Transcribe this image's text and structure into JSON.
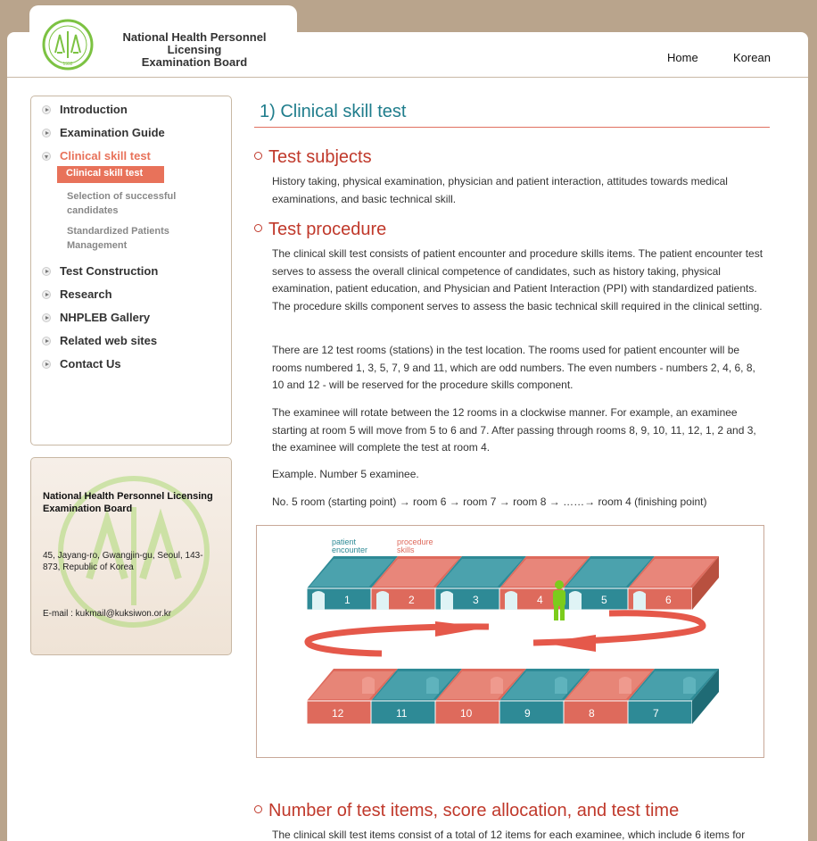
{
  "header": {
    "org_name_line1": "National Health Personnel Licensing",
    "org_name_line2": "Examination Board",
    "emblem_year": "1992",
    "nav": [
      {
        "label": "Home"
      },
      {
        "label": "Korean"
      }
    ]
  },
  "sidebar": {
    "items": [
      {
        "label": "Introduction"
      },
      {
        "label": "Examination Guide"
      },
      {
        "label": "Clinical skill test"
      },
      {
        "label": "Test Construction"
      },
      {
        "label": "Research"
      },
      {
        "label": "NHPLEB Gallery"
      },
      {
        "label": "Related web sites"
      },
      {
        "label": "Contact Us"
      }
    ],
    "subitems": [
      {
        "label": "Clinical skill test"
      },
      {
        "label": "Selection of successful candidates"
      },
      {
        "label": "Standardized Patients Management"
      }
    ]
  },
  "address": {
    "org": "National Health Personnel Licensing Examination Board",
    "street": "45, Jayang-ro, Gwangjin-gu, Seoul, 143-873, Republic of Korea",
    "email": "E-mail : kukmail@kuksiwon.or.kr"
  },
  "main": {
    "title": "1) Clinical skill test",
    "sections": [
      {
        "heading": "Test subjects"
      },
      {
        "heading": "Test procedure"
      },
      {
        "heading": "Number of test items, score allocation, and test time"
      }
    ],
    "paragraphs": [
      "History taking, physical examination, physician and patient interaction, attitudes towards medical examinations, and basic technical skill.",
      "The clinical skill test consists of patient encounter and procedure skills items. The patient encounter test serves to assess the overall clinical competence of candidates, such as history taking, physical examination, patient education, and Physician and Patient Interaction (PPI) with standardized patients. The procedure skills component serves to assess the basic technical skill required in the clinical setting.",
      "There are 12 test rooms (stations) in the test location. The rooms used for patient encounter will be rooms numbered 1, 3, 5, 7, 9 and 11, which are odd numbers. The even numbers - numbers 2, 4, 6, 8, 10 and 12 - will be reserved for the procedure skills component.",
      "The examinee will rotate between the 12 rooms in a clockwise manner. For example, an examinee starting at room 5 will move from 5 to 6 and 7. After passing through rooms 8, 9, 10, 11, 12, 1, 2 and 3, the examinee will complete the test at room 4.",
      "Example. Number 5 examinee.",
      "No. 5 room (starting point) → room 6 → room 7 → room 8 → ……→ room 4 (finishing point)",
      "The clinical skill test items consist of a total of 12 items for each examinee, which include 6 items for"
    ]
  },
  "figure": {
    "legend_patient": [
      "patient",
      "encounter"
    ],
    "legend_procedure": [
      "procedure",
      "skills"
    ],
    "top_rooms": [
      "1",
      "2",
      "3",
      "4",
      "5",
      "6"
    ],
    "bottom_rooms": [
      "12",
      "11",
      "10",
      "9",
      "8",
      "7"
    ],
    "colors": {
      "teal": "#2e8a96",
      "coral": "#de6a5c",
      "person": "#7ccc1c"
    }
  }
}
